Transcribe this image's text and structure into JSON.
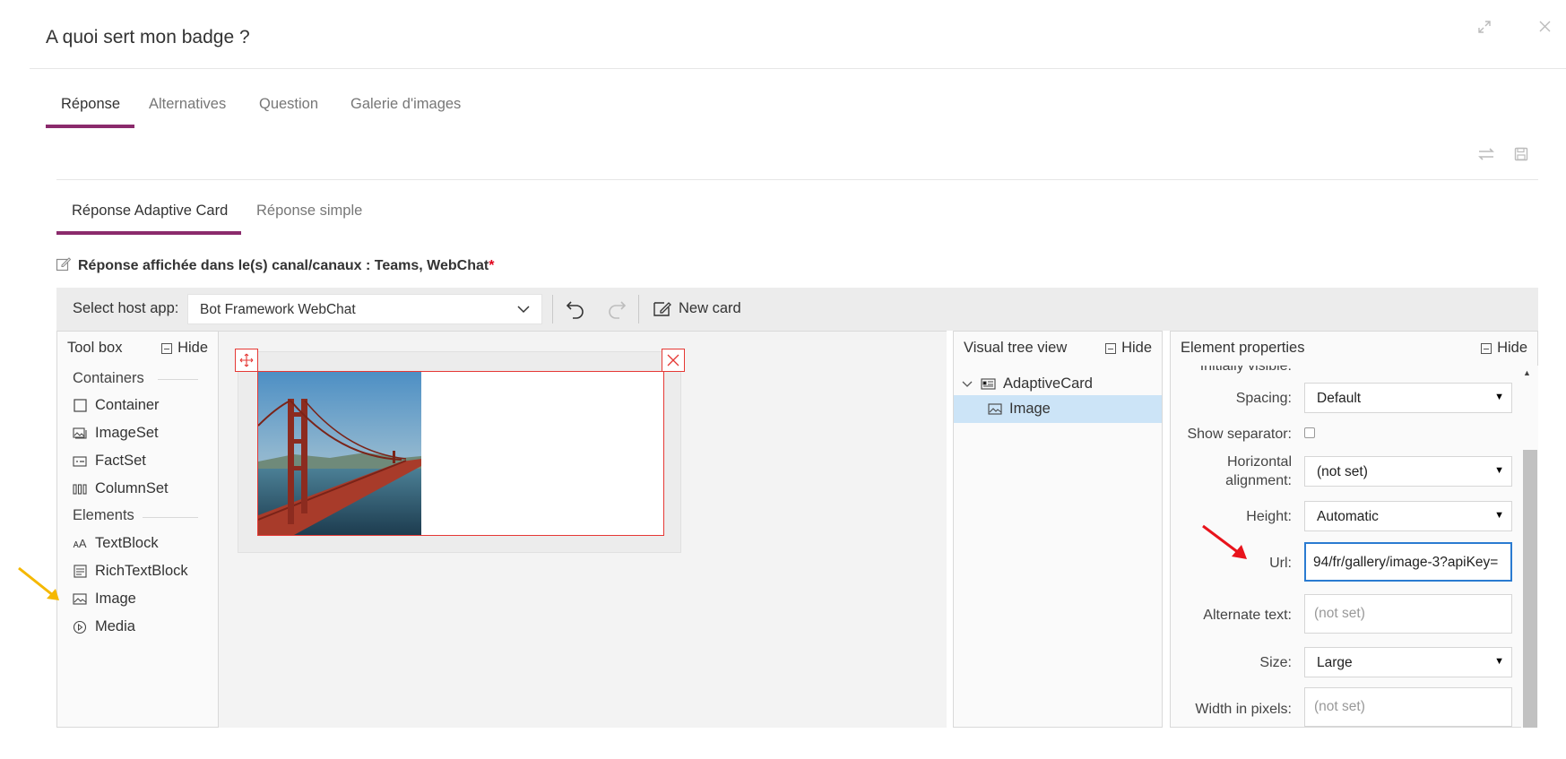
{
  "dialog": {
    "title": "A quoi sert mon badge ?",
    "expand_icon": "expand-icon",
    "close_icon": "close-icon"
  },
  "tabs": [
    {
      "label": "Réponse",
      "active": true
    },
    {
      "label": "Alternatives",
      "active": false
    },
    {
      "label": "Question",
      "active": false
    },
    {
      "label": "Galerie d'images",
      "active": false
    }
  ],
  "toolbar_icons": [
    "swap-icon",
    "save-icon"
  ],
  "subtabs": [
    {
      "label": "Réponse Adaptive Card",
      "active": true
    },
    {
      "label": "Réponse simple",
      "active": false
    }
  ],
  "channels_note": {
    "text": "Réponse affichée dans le(s) canal/canaux : Teams, WebChat",
    "required_mark": "*"
  },
  "designer_toolbar": {
    "host_label": "Select host app:",
    "host_value": "Bot Framework WebChat",
    "new_card_label": "New card"
  },
  "toolbox": {
    "title": "Tool box",
    "hide_label": "Hide",
    "groups": [
      {
        "name": "Containers",
        "items": [
          "Container",
          "ImageSet",
          "FactSet",
          "ColumnSet"
        ]
      },
      {
        "name": "Elements",
        "items": [
          "TextBlock",
          "RichTextBlock",
          "Image",
          "Media"
        ]
      }
    ]
  },
  "visual_tree": {
    "title": "Visual tree view",
    "hide_label": "Hide",
    "root": "AdaptiveCard",
    "child": "Image"
  },
  "element_properties": {
    "title": "Element properties",
    "hide_label": "Hide",
    "partial_label": "Initially visible:",
    "spacing_label": "Spacing:",
    "spacing_value": "Default",
    "separator_label": "Show separator:",
    "halign_label_1": "Horizontal",
    "halign_label_2": "alignment:",
    "halign_value": "(not set)",
    "height_label": "Height:",
    "height_value": "Automatic",
    "url_label": "Url:",
    "url_value": "94/fr/gallery/image-3?apiKey=",
    "alt_label": "Alternate text:",
    "alt_placeholder": "(not set)",
    "size_label": "Size:",
    "size_value": "Large",
    "width_label": "Width in pixels:",
    "width_placeholder": "(not set)"
  },
  "colors": {
    "accent": "#8b2a6c",
    "selection": "#cce4f7",
    "designer_red": "#e53935",
    "arrow_red": "#e8131b",
    "arrow_yellow": "#f5b800"
  }
}
